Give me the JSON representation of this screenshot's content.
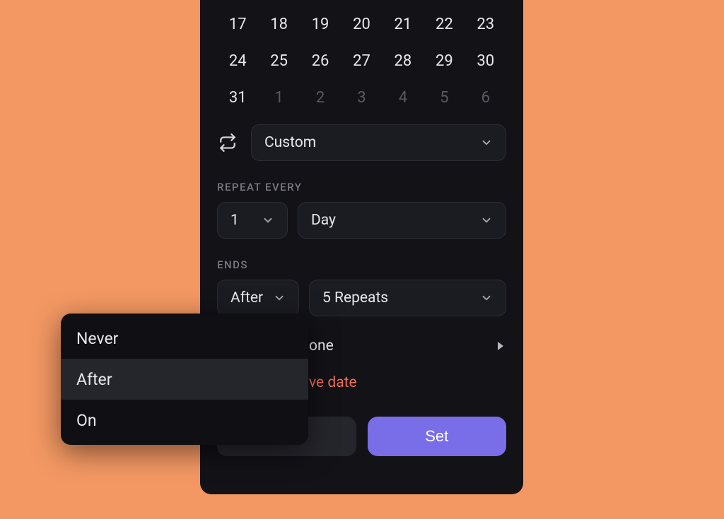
{
  "calendar": {
    "rows": [
      [
        {
          "d": "17"
        },
        {
          "d": "18"
        },
        {
          "d": "19"
        },
        {
          "d": "20"
        },
        {
          "d": "21"
        },
        {
          "d": "22"
        },
        {
          "d": "23"
        }
      ],
      [
        {
          "d": "24"
        },
        {
          "d": "25"
        },
        {
          "d": "26"
        },
        {
          "d": "27"
        },
        {
          "d": "28"
        },
        {
          "d": "29"
        },
        {
          "d": "30"
        }
      ],
      [
        {
          "d": "31"
        },
        {
          "d": "1",
          "next": true
        },
        {
          "d": "2",
          "next": true
        },
        {
          "d": "3",
          "next": true
        },
        {
          "d": "4",
          "next": true
        },
        {
          "d": "5",
          "next": true
        },
        {
          "d": "6",
          "next": true
        }
      ]
    ]
  },
  "repeat": {
    "mode": "Custom"
  },
  "repeat_every": {
    "label": "REPEAT EVERY",
    "count": "1",
    "unit": "Day"
  },
  "ends": {
    "label": "ENDS",
    "mode": "After",
    "detail": "5 Repeats"
  },
  "timezone": {
    "label_fragment": "one"
  },
  "remove": {
    "label_fragment": "ve date"
  },
  "footer": {
    "cancel": "",
    "set": "Set"
  },
  "dropdown": {
    "items": [
      {
        "label": "Never",
        "active": false
      },
      {
        "label": "After",
        "active": true
      },
      {
        "label": "On",
        "active": false
      }
    ]
  }
}
